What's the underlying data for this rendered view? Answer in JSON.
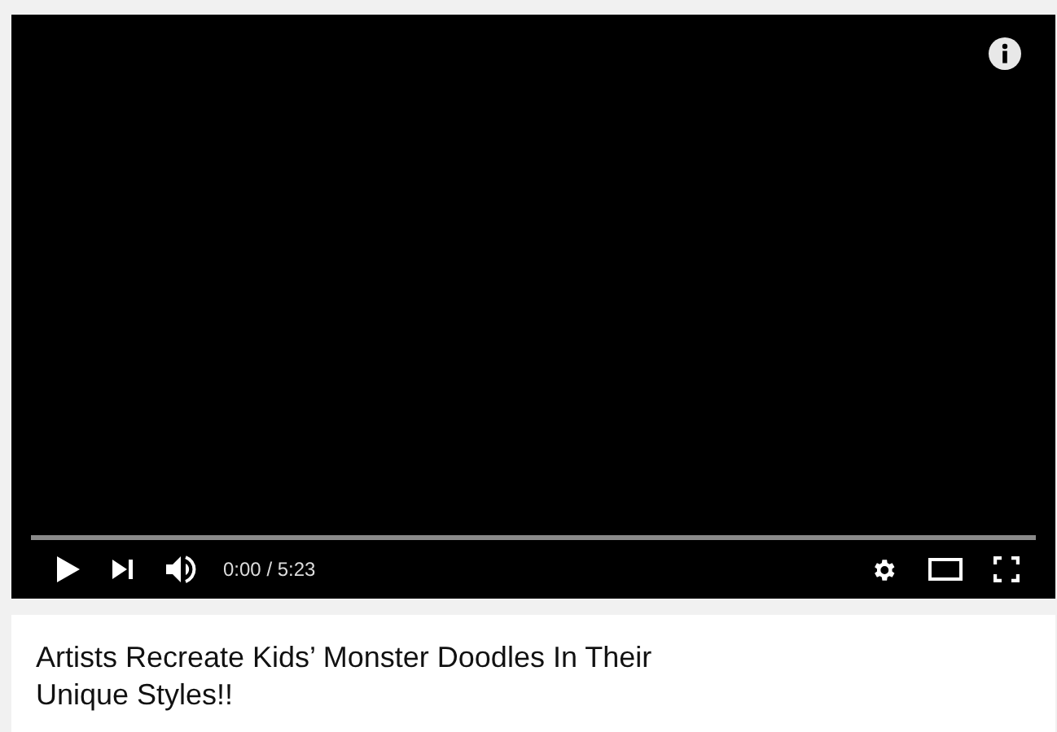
{
  "player": {
    "progress": {
      "level": 0
    },
    "time": "0:00 / 5:23"
  },
  "video_title": "Artists Recreate Kids’ Monster Doodles In Their Unique Styles!!"
}
